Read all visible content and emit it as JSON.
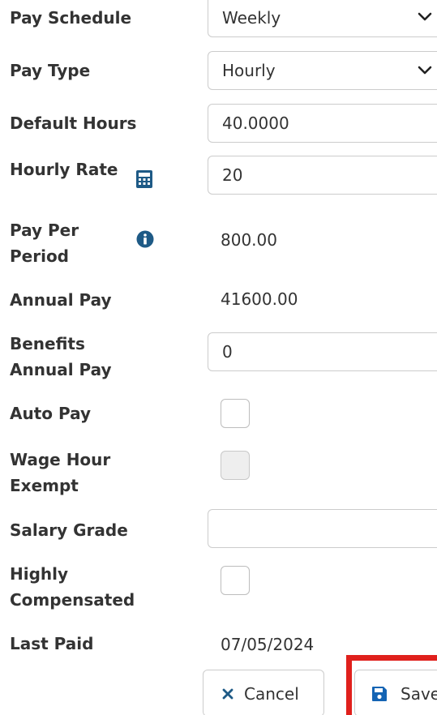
{
  "form": {
    "pay_schedule": {
      "label": "Pay Schedule",
      "value": "Weekly"
    },
    "pay_type": {
      "label": "Pay Type",
      "value": "Hourly"
    },
    "default_hours": {
      "label": "Default Hours",
      "value": "40.0000"
    },
    "hourly_rate": {
      "label": "Hourly Rate",
      "value": "20",
      "icon": "calculator-icon"
    },
    "pay_per_period": {
      "label_line1": "Pay Per",
      "label_line2": "Period",
      "value": "800.00",
      "icon": "info-icon"
    },
    "annual_pay": {
      "label": "Annual Pay",
      "value": "41600.00"
    },
    "benefits_annual_pay": {
      "label_line1": "Benefits",
      "label_line2": "Annual Pay",
      "value": "0"
    },
    "auto_pay": {
      "label": "Auto Pay",
      "checked": false
    },
    "wage_hour_exempt": {
      "label_line1": "Wage Hour",
      "label_line2": "Exempt",
      "checked": false,
      "disabled": true
    },
    "salary_grade": {
      "label": "Salary Grade",
      "value": ""
    },
    "highly_compensated": {
      "label_line1": "Highly",
      "label_line2": "Compensated",
      "checked": false
    },
    "last_paid": {
      "label": "Last Paid",
      "value": "07/05/2024"
    }
  },
  "actions": {
    "cancel_label": "Cancel",
    "save_label": "Save"
  },
  "colors": {
    "label_text": "#333333",
    "icon_blue": "#1e5a86",
    "save_icon": "#1464b4",
    "cancel_icon": "#1e5a86",
    "highlight": "#e0201c"
  }
}
